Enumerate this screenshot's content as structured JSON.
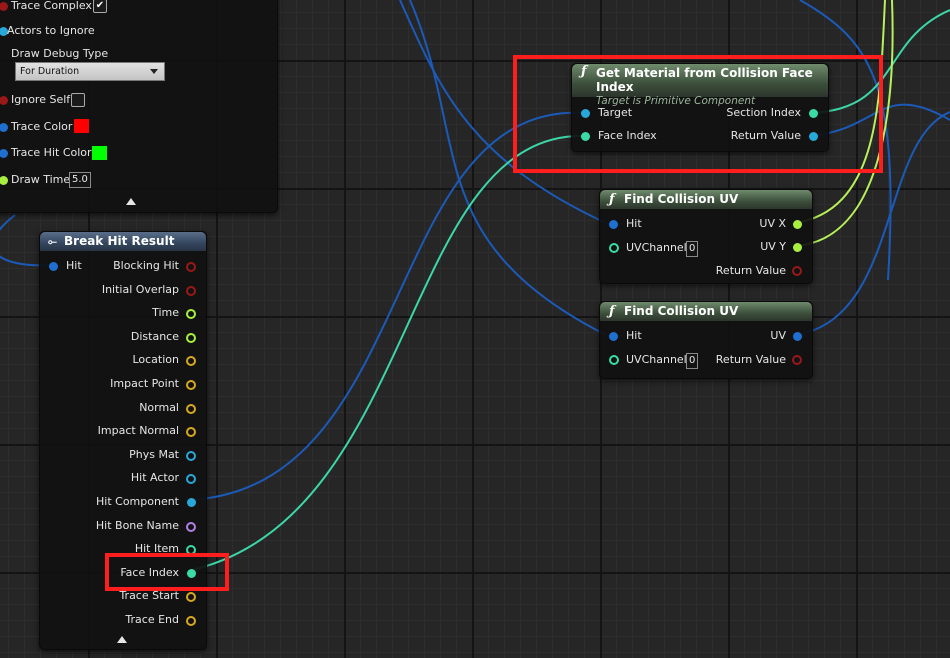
{
  "colors": {
    "wire_blue": "#1c5ab8",
    "wire_teal": "#3cd7a8",
    "wire_lime": "#b7f05a",
    "pin_blue": "#1e6fd0",
    "pin_teal": "#3bdba6",
    "pin_lime": "#a8f040",
    "pin_gold": "#d8a820",
    "pin_red": "#9a1818",
    "pin_cyan": "#28a8d8",
    "pin_purple": "#b080e8",
    "highlight": "#ff1e1e"
  },
  "trace_node": {
    "trace_complex": "Trace Complex",
    "trace_complex_checked": "✔",
    "actors_to_ignore": "Actors to Ignore",
    "draw_debug_type": "Draw Debug Type",
    "draw_debug_value": "For Duration",
    "ignore_self": "Ignore Self",
    "trace_color": "Trace Color",
    "trace_color_value": "#ff0000",
    "trace_hit_color": "Trace Hit Color",
    "trace_hit_color_value": "#00ff00",
    "draw_time": "Draw Time",
    "draw_time_value": "5.0"
  },
  "break_hit": {
    "title": "Break Hit Result",
    "input": "Hit",
    "outputs": [
      "Blocking Hit",
      "Initial Overlap",
      "Time",
      "Distance",
      "Location",
      "Impact Point",
      "Normal",
      "Impact Normal",
      "Phys Mat",
      "Hit Actor",
      "Hit Component",
      "Hit Bone Name",
      "Hit Item",
      "Face Index",
      "Trace Start",
      "Trace End"
    ]
  },
  "get_material": {
    "title": "Get Material from Collision Face Index",
    "subtitle": "Target is Primitive Component",
    "inputs": [
      "Target",
      "Face Index"
    ],
    "outputs": [
      "Section Index",
      "Return Value"
    ]
  },
  "find_uv_1": {
    "title": "Find Collision UV",
    "inputs": [
      "Hit",
      "UVChannel"
    ],
    "uv_channel_value": "0",
    "outputs": [
      "UV X",
      "UV Y",
      "Return Value"
    ]
  },
  "find_uv_2": {
    "title": "Find Collision UV",
    "inputs": [
      "Hit",
      "UVChannel"
    ],
    "uv_channel_value": "0",
    "outputs": [
      "UV",
      "Return Value"
    ]
  },
  "icons": [
    "function-icon",
    "break-struct-icon",
    "collapse-arrow-icon",
    "dropdown-arrow-icon",
    "checkbox-icon"
  ]
}
